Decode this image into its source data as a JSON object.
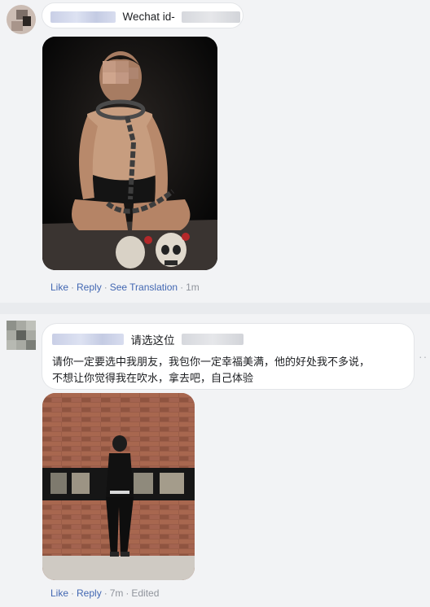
{
  "comment1": {
    "text": "Wechat id-",
    "actions": {
      "like": "Like",
      "reply": "Reply",
      "see_translation": "See Translation",
      "time": "1m"
    }
  },
  "comment2": {
    "title": "请选这位",
    "body_line1": "请你一定要选中我朋友，我包你一定幸福美满，他的好处我不多说，",
    "body_line2": "不想让你觉得我在吹水，拿去吧，自己体验",
    "actions": {
      "like": "Like",
      "reply": "Reply",
      "time": "7m",
      "edited": "Edited"
    }
  },
  "colors": {
    "link": "#4267b2",
    "meta": "#90949c",
    "background": "#f2f3f5",
    "bubble": "#ffffff"
  },
  "icons": [
    "more-options-icon"
  ]
}
